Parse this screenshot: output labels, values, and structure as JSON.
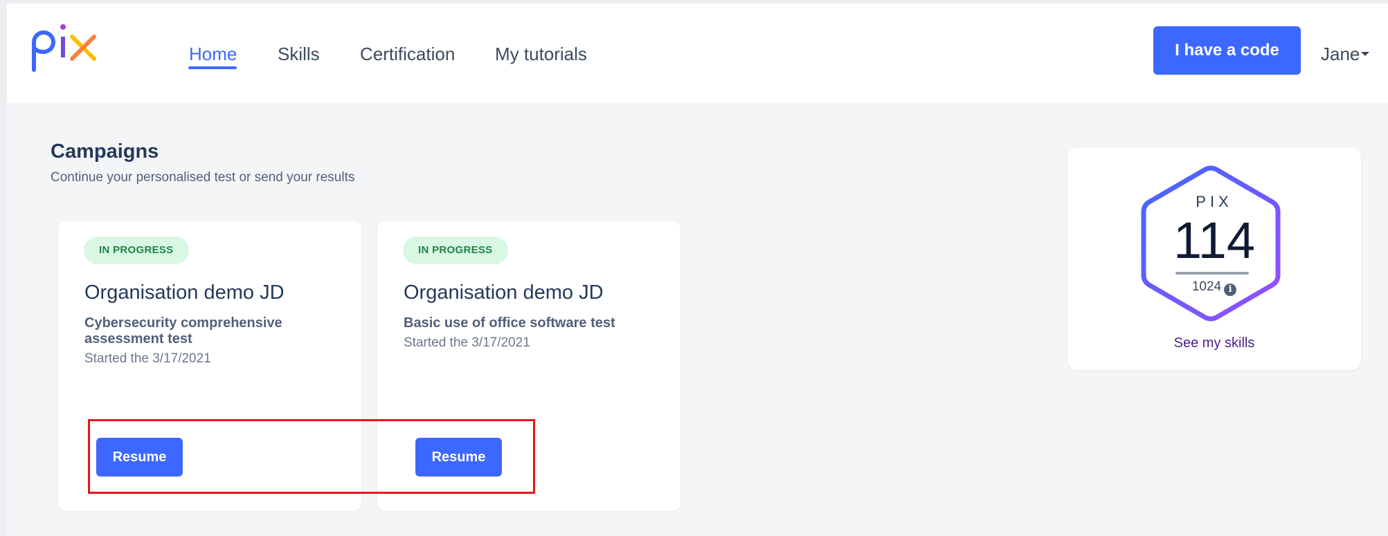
{
  "app": {
    "logo_text": "pix",
    "colors": {
      "primary": "#3d68ff",
      "badge_bg": "#d9f7e3",
      "badge_text": "#1f8447",
      "highlight": "#e8151a",
      "link": "#4a1d87"
    }
  },
  "nav": {
    "items": [
      {
        "label": "Home",
        "active": true
      },
      {
        "label": "Skills",
        "active": false
      },
      {
        "label": "Certification",
        "active": false
      },
      {
        "label": "My tutorials",
        "active": false
      }
    ],
    "code_button": "I have a code",
    "user_name": "Jane"
  },
  "campaigns": {
    "title": "Campaigns",
    "subtitle": "Continue your personalised test or send your results",
    "cards": [
      {
        "status": "IN PROGRESS",
        "organisation": "Organisation demo JD",
        "campaign": "Cybersecurity comprehensive assessment test",
        "started": "Started the 3/17/2021",
        "action": "Resume"
      },
      {
        "status": "IN PROGRESS",
        "organisation": "Organisation demo JD",
        "campaign": "Basic use of office software test",
        "started": "Started the 3/17/2021",
        "action": "Resume"
      }
    ]
  },
  "score": {
    "label": "PIX",
    "value": "114",
    "max": "1024",
    "info_icon": "info-icon",
    "link": "See my skills"
  }
}
